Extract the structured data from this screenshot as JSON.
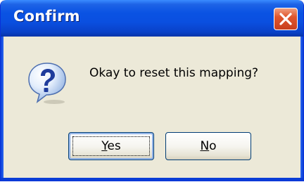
{
  "window": {
    "title": "Confirm"
  },
  "dialog": {
    "icon": "question-icon",
    "message": "Okay to reset this mapping?"
  },
  "buttons": {
    "yes": {
      "mnemonic": "Y",
      "rest": "es"
    },
    "no": {
      "mnemonic": "N",
      "rest": "o"
    }
  },
  "colors": {
    "titlebar": "#0a4fe0",
    "close_button": "#e0562d",
    "dialog_background": "#ece9d8",
    "button_border": "#003c74"
  }
}
